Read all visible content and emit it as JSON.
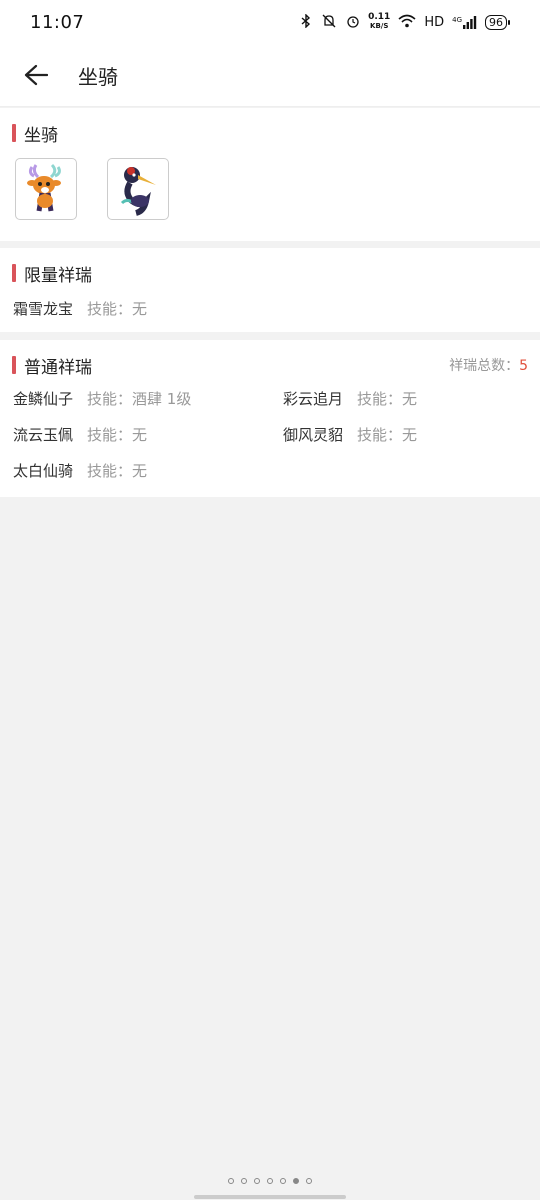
{
  "status": {
    "time": "11:07",
    "speed_top": "0.11",
    "speed_unit": "KB/S",
    "hd": "HD",
    "net": "4G",
    "battery": "96"
  },
  "header": {
    "title": "坐骑"
  },
  "mounts_section": {
    "title": "坐骑",
    "items": [
      {
        "icon": "deer-mount-icon"
      },
      {
        "icon": "crane-mount-icon"
      }
    ]
  },
  "limited_section": {
    "title": "限量祥瑞",
    "items": [
      {
        "name": "霜雪龙宝",
        "skill": "技能：无"
      }
    ]
  },
  "normal_section": {
    "title": "普通祥瑞",
    "total_label": "祥瑞总数：",
    "total_value": "5",
    "rows": [
      [
        {
          "name": "金鳞仙子",
          "skill": "技能：酒肆 1级"
        },
        {
          "name": "彩云追月",
          "skill": "技能：无"
        }
      ],
      [
        {
          "name": "流云玉佩",
          "skill": "技能：无"
        },
        {
          "name": "御风灵貂",
          "skill": "技能：无"
        }
      ],
      [
        {
          "name": "太白仙骑",
          "skill": "技能：无"
        }
      ]
    ]
  },
  "pager": {
    "count": 7,
    "active_index": 5
  }
}
